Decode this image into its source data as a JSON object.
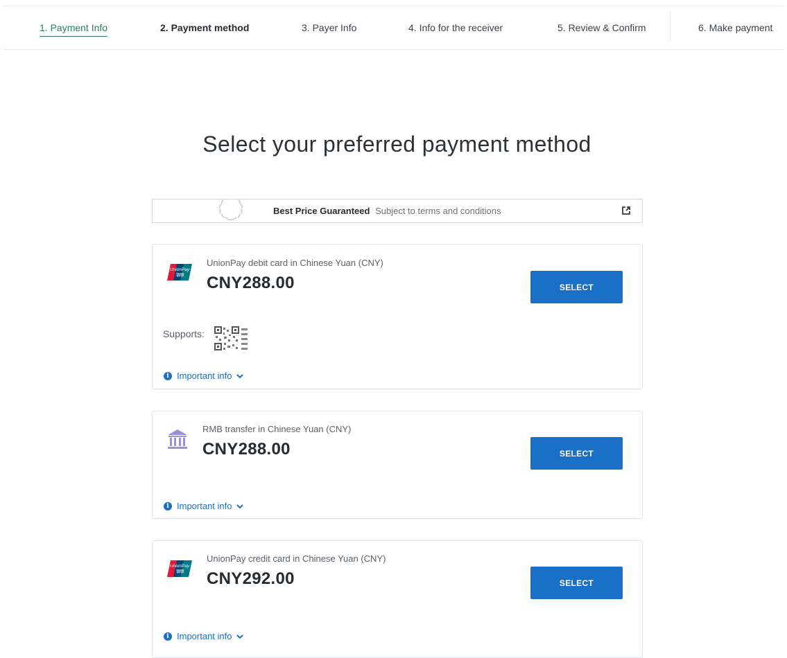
{
  "steps": [
    {
      "label": "1. Payment Info",
      "state": "completed"
    },
    {
      "label": "2. Payment method",
      "state": "current"
    },
    {
      "label": "3. Payer Info",
      "state": "upcoming"
    },
    {
      "label": "4. Info for the receiver",
      "state": "upcoming"
    },
    {
      "label": "5. Review & Confirm",
      "state": "upcoming"
    },
    {
      "label": "6. Make payment",
      "state": "upcoming"
    }
  ],
  "title": "Select your preferred payment method",
  "best_price": {
    "heading": "Best Price Guaranteed",
    "subtext": "Subject to terms and conditions",
    "icon": "external-link-icon"
  },
  "options": [
    {
      "logo": "unionpay-logo",
      "caption": "UnionPay debit card in Chinese Yuan (CNY)",
      "price": "CNY288.00",
      "button": "SELECT",
      "supports_label": "Supports:",
      "supports_icon": "qr-code-icon",
      "info_label": "Important info"
    },
    {
      "logo": "bank-icon",
      "caption": "RMB transfer in Chinese Yuan (CNY)",
      "price": "CNY288.00",
      "button": "SELECT",
      "info_label": "Important info"
    },
    {
      "logo": "unionpay-logo",
      "caption": "UnionPay credit card in Chinese Yuan (CNY)",
      "price": "CNY292.00",
      "button": "SELECT",
      "info_label": "Important info"
    }
  ],
  "colors": {
    "accent_blue": "#1a6fc7",
    "step_active_green": "#2c7a63",
    "bank_icon_purple": "#9c8fe0"
  }
}
